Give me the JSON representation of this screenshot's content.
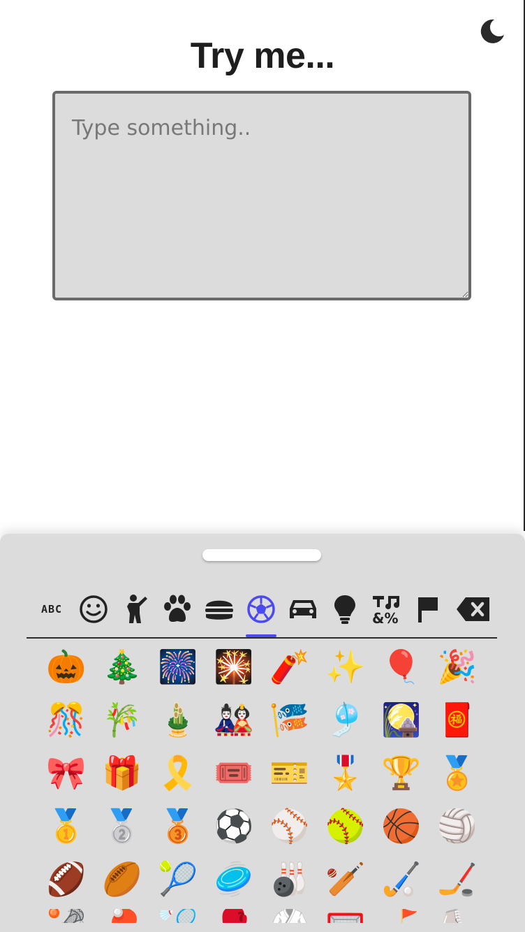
{
  "page": {
    "title": "Try me...",
    "textarea_placeholder": "Type something..",
    "textarea_value": ""
  },
  "header": {
    "theme_toggle_icon": "moon-icon"
  },
  "keyboard": {
    "categories": [
      {
        "name": "abc",
        "label": "ABC",
        "icon": "abc-icon",
        "active": false
      },
      {
        "name": "smileys",
        "icon": "smiley-icon",
        "active": false
      },
      {
        "name": "people",
        "icon": "person-icon",
        "active": false
      },
      {
        "name": "animals",
        "icon": "paw-icon",
        "active": false
      },
      {
        "name": "food",
        "icon": "burger-icon",
        "active": false
      },
      {
        "name": "activities",
        "icon": "soccer-ball-icon",
        "active": true
      },
      {
        "name": "travel",
        "icon": "car-icon",
        "active": false
      },
      {
        "name": "objects",
        "icon": "lightbulb-icon",
        "active": false
      },
      {
        "name": "symbols",
        "icon": "symbols-icon",
        "active": false
      },
      {
        "name": "flags",
        "icon": "flag-icon",
        "active": false
      },
      {
        "name": "backspace",
        "icon": "backspace-icon",
        "active": false
      }
    ],
    "active_color": "#4a4af0",
    "rows": [
      [
        "🎃",
        "🎄",
        "🎆",
        "🎇",
        "🧨",
        "✨",
        "🎈",
        "🎉"
      ],
      [
        "🎊",
        "🎋",
        "🎍",
        "🎎",
        "🎏",
        "🎐",
        "🎑",
        "🧧"
      ],
      [
        "🎀",
        "🎁",
        "🎗️",
        "🎟️",
        "🎫",
        "🎖️",
        "🏆",
        "🏅"
      ],
      [
        "🥇",
        "🥈",
        "🥉",
        "⚽",
        "⚾",
        "🥎",
        "🏀",
        "🏐"
      ],
      [
        "🏈",
        "🏉",
        "🎾",
        "🥏",
        "🎳",
        "🏏",
        "🏑",
        "🏒"
      ]
    ],
    "partial_row": [
      "🥍",
      "🏓",
      "🏸",
      "🥊",
      "🥋",
      "🥅",
      "⛳",
      "⛸️"
    ]
  }
}
